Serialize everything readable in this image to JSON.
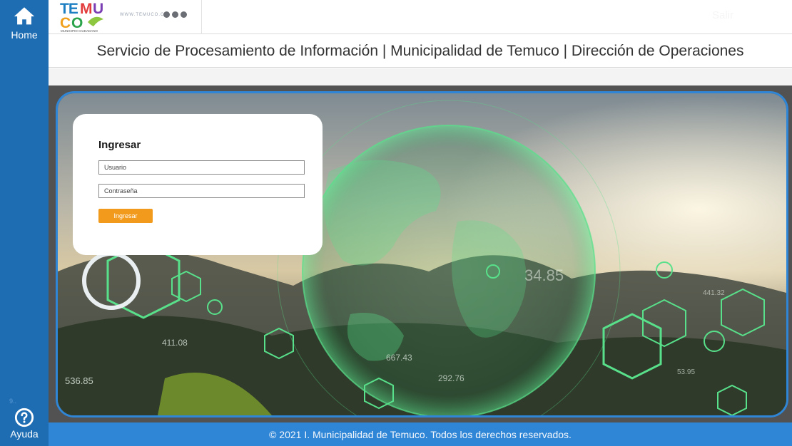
{
  "sidebar": {
    "home_label": "Home",
    "home_icon": "home-icon",
    "help_label": "Ayuda",
    "help_icon": "help-circle-icon",
    "version": "9.."
  },
  "header": {
    "logo_text_top": "TEMU",
    "logo_text_bottom": "CO",
    "logo_tagline": "MUNICIPIO CIUDADANO",
    "site_url": "WWW.TEMUCO.CL",
    "social_icons": [
      "facebook-icon",
      "twitter-icon",
      "instagram-icon"
    ],
    "logout_label": "Salir"
  },
  "page_title": "Servicio de Procesamiento de Información | Municipalidad de Temuco | Dirección de Operaciones",
  "hero": {
    "numbers": [
      "411.08",
      "536.85",
      "667.43",
      "292.76",
      "34.85",
      "441.32",
      "53.95"
    ]
  },
  "login": {
    "heading": "Ingresar",
    "username_placeholder": "Usuario",
    "password_placeholder": "Contraseña",
    "submit_label": "Ingresar"
  },
  "footer": {
    "copyright": "© 2021 I. Municipalidad de Temuco. Todos los derechos reservados."
  },
  "colors": {
    "sidebar": "#1e6db3",
    "accent": "#2f86d6",
    "button": "#f29a1b",
    "glow": "#58e08a"
  }
}
